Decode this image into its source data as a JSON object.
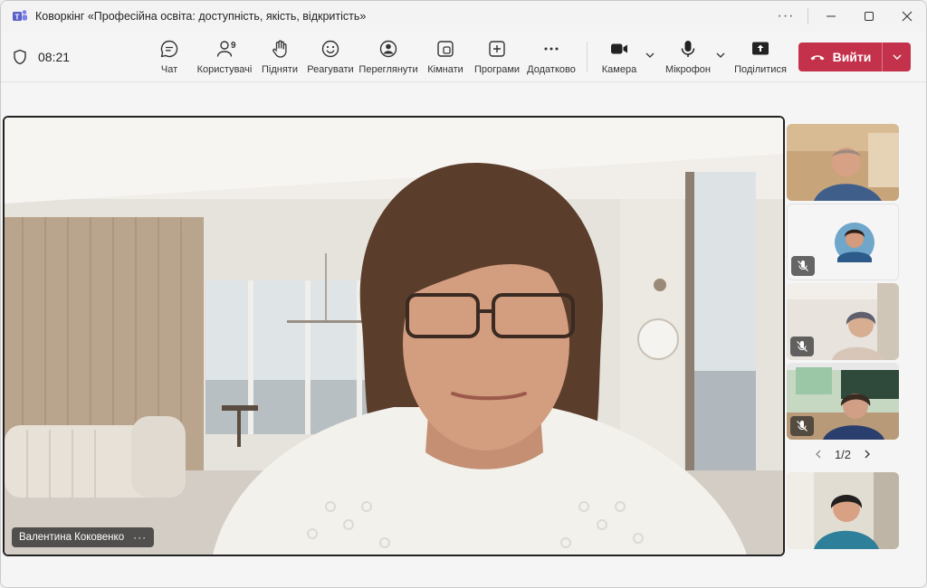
{
  "window": {
    "title": "Коворкінг «Професійна освіта: доступність, якість, відкритість»",
    "more_label": "···",
    "controls": [
      "minimize",
      "maximize",
      "close"
    ]
  },
  "toolbar": {
    "time": "08:21",
    "items": [
      {
        "id": "chat",
        "label": "Чат",
        "icon": "chat-icon"
      },
      {
        "id": "people",
        "label": "Користувачі",
        "icon": "people-icon",
        "count": "9"
      },
      {
        "id": "raise",
        "label": "Підняти",
        "icon": "raise-hand-icon"
      },
      {
        "id": "react",
        "label": "Реагувати",
        "icon": "smile-icon"
      },
      {
        "id": "view",
        "label": "Переглянути",
        "icon": "view-icon"
      },
      {
        "id": "rooms",
        "label": "Кімнати",
        "icon": "rooms-icon"
      },
      {
        "id": "apps",
        "label": "Програми",
        "icon": "apps-plus-icon"
      },
      {
        "id": "more",
        "label": "Додатково",
        "icon": "more-icon"
      },
      {
        "id": "camera",
        "label": "Камера",
        "icon": "camera-icon"
      },
      {
        "id": "mic",
        "label": "Мікрофон",
        "icon": "microphone-icon"
      },
      {
        "id": "share",
        "label": "Поділитися",
        "icon": "share-icon"
      }
    ],
    "leave_label": "Вийти",
    "leave_color": "#c4314b"
  },
  "stage": {
    "speaker_name": "Валентина Коковенко",
    "more_label": "···",
    "pager": "1/2",
    "thumbnails": [
      {
        "id": "t1",
        "muted": false
      },
      {
        "id": "t2",
        "muted": true
      },
      {
        "id": "t3",
        "muted": true
      },
      {
        "id": "t4",
        "muted": true
      },
      {
        "id": "t5",
        "muted": false
      }
    ]
  }
}
